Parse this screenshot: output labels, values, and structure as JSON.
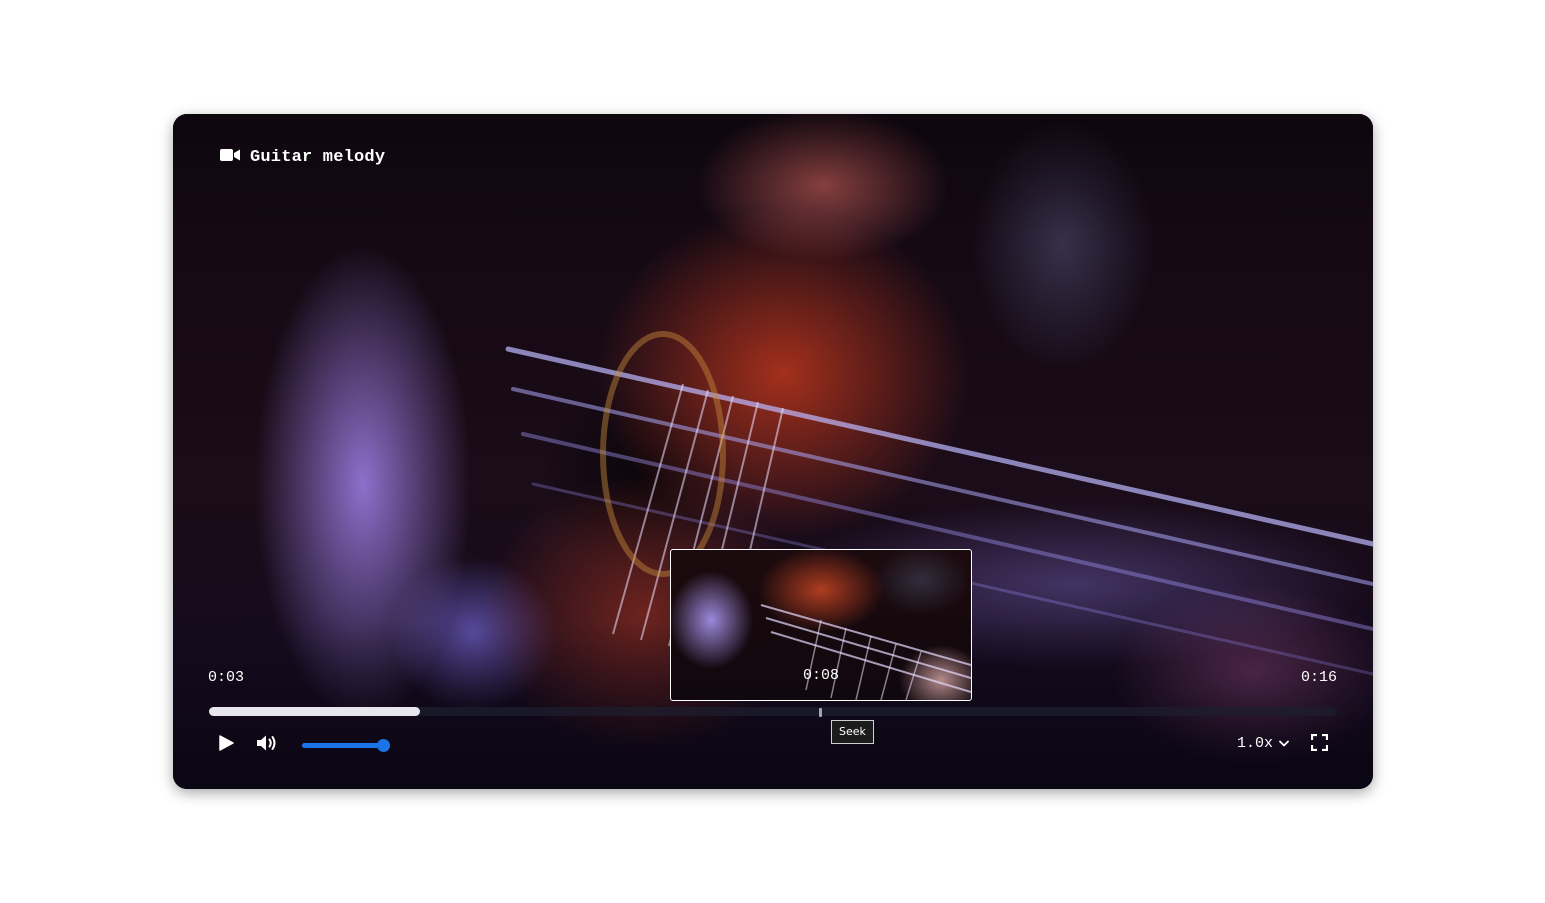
{
  "player": {
    "title": "Guitar melody",
    "title_icon": "video-camera-icon",
    "current_time": "0:03",
    "total_time": "0:16",
    "played_fraction": 0.187,
    "seek_preview_time": "0:08",
    "seek_tooltip": "Seek",
    "volume_fraction": 0.92,
    "speed_label": "1.0x",
    "accent_color": "#1a73e8",
    "icons": {
      "play": "play-icon",
      "volume": "volume-high-icon",
      "speed": "chevron-down-icon",
      "fullscreen": "fullscreen-icon"
    }
  }
}
